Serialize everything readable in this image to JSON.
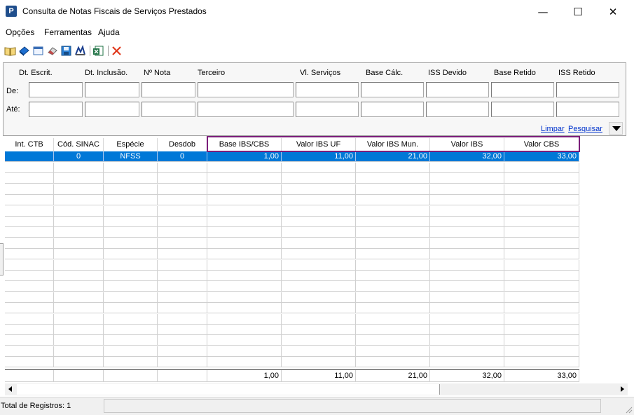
{
  "window": {
    "icon_letter": "P",
    "title": "Consulta de Notas Fiscais de Serviços Prestados",
    "min_glyph": "—",
    "max_glyph": "☐",
    "close_glyph": "✕"
  },
  "menu": [
    "Opções",
    "Ferramentas",
    "Ajuda"
  ],
  "toolbar": {
    "icons": [
      "open-book-icon",
      "blue-book-icon",
      "window-icon",
      "eraser-icon",
      "save-disk-icon",
      "chart-icon",
      "excel-export-icon",
      "close-red-x-icon"
    ]
  },
  "filter": {
    "columns": [
      "Dt. Escrit.",
      "Dt. Inclusão.",
      "Nº Nota",
      "Terceiro",
      "Vl. Serviços",
      "Base Cálc.",
      "ISS Devido",
      "Base Retido",
      "ISS Retido"
    ],
    "row_de": "De:",
    "row_ate": "Até:",
    "limpar": "Limpar",
    "pesquisar": "Pesquisar"
  },
  "grid": {
    "columns": [
      "Int. CTB",
      "Cód. SINAC",
      "Espécie",
      "Desdob",
      "Base IBS/CBS",
      "Valor IBS UF",
      "Valor IBS Mun.",
      "Valor IBS",
      "Valor CBS"
    ],
    "rows": [
      [
        "",
        "0",
        "NFSS",
        "0",
        "1,00",
        "11,00",
        "21,00",
        "32,00",
        "33,00"
      ]
    ],
    "totals": [
      "",
      "",
      "",
      "",
      "1,00",
      "11,00",
      "21,00",
      "32,00",
      "33,00"
    ],
    "selected_color": "#0078d7",
    "highlight_color": "#7b1e7a"
  },
  "status": {
    "text": "Total de Registros: 1"
  }
}
